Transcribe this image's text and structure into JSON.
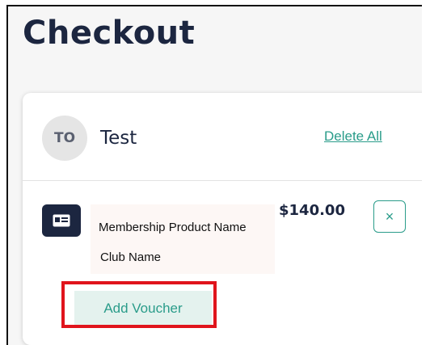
{
  "page": {
    "title": "Checkout"
  },
  "customer": {
    "initials": "TO",
    "name": "Test",
    "delete_all_label": "Delete All"
  },
  "item": {
    "icon": "id-card-icon",
    "product_name": "Membership Product Name",
    "club_name": "Club Name",
    "price": "$140.00",
    "remove_symbol": "×",
    "add_voucher_label": "Add Voucher"
  },
  "colors": {
    "navy": "#1c2640",
    "teal": "#2a9c8a",
    "voucher_bg": "#e4f2ee",
    "highlight": "#e0141c"
  }
}
